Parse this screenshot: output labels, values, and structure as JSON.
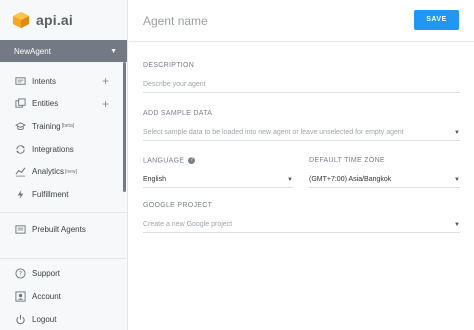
{
  "brand": {
    "name": "api.ai",
    "accent": "#f5a623"
  },
  "agent_selector": {
    "value": "NewAgent"
  },
  "nav": {
    "items": [
      {
        "label": "Intents",
        "icon": "chat-bubble-icon",
        "has_add": true
      },
      {
        "label": "Entities",
        "icon": "entities-icon",
        "has_add": true
      },
      {
        "label": "Training",
        "icon": "graduation-cap-icon",
        "badge": "[beta]"
      },
      {
        "label": "Integrations",
        "icon": "sync-icon"
      },
      {
        "label": "Analytics",
        "icon": "chart-icon",
        "badge": "[new]"
      },
      {
        "label": "Fulfillment",
        "icon": "bolt-icon"
      }
    ],
    "add_symbol": "+",
    "secondary": [
      {
        "label": "Prebuilt Agents",
        "icon": "briefcase-icon"
      }
    ],
    "bottom": [
      {
        "label": "Support",
        "icon": "help-circle-icon"
      },
      {
        "label": "Account",
        "icon": "account-icon"
      },
      {
        "label": "Logout",
        "icon": "power-icon"
      }
    ]
  },
  "header": {
    "title": "Agent name",
    "save_label": "SAVE",
    "save_color": "#2196f3"
  },
  "form": {
    "description": {
      "label": "DESCRIPTION",
      "placeholder": "Describe your agent"
    },
    "sample_data": {
      "label": "ADD SAMPLE DATA",
      "placeholder": "Select sample data to be loaded into new agent or leave unselected for empty agent"
    },
    "language": {
      "label": "LANGUAGE",
      "value": "English"
    },
    "timezone": {
      "label": "DEFAULT TIME ZONE",
      "value": "(GMT+7:00) Asia/Bangkok"
    },
    "google_project": {
      "label": "GOOGLE PROJECT",
      "placeholder": "Create a new Google project"
    }
  }
}
